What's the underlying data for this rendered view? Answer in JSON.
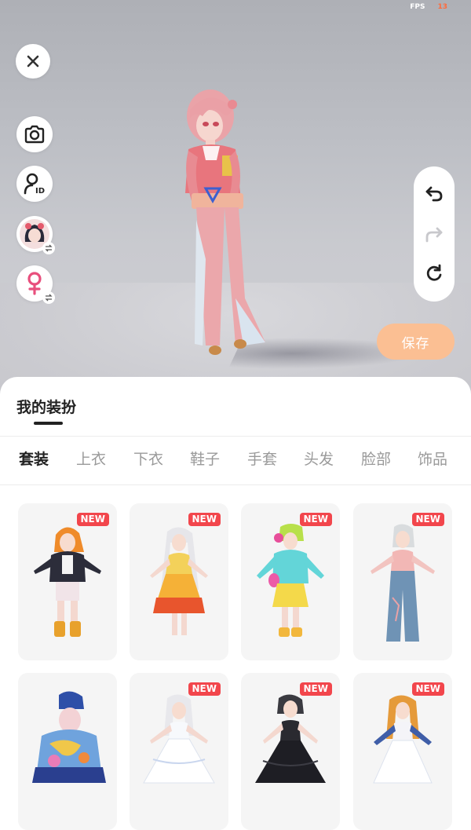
{
  "fps": {
    "label": "FPS",
    "value": "13"
  },
  "actions": {
    "save_label": "保存"
  },
  "sheet": {
    "title": "我的装扮",
    "tabs": [
      "套装",
      "上衣",
      "下衣",
      "鞋子",
      "手套",
      "头发",
      "脸部",
      "饰品"
    ],
    "active_tab": "套装"
  },
  "items": [
    {
      "badge": "NEW",
      "outfit": "black-jacket-orange-hair"
    },
    {
      "badge": "NEW",
      "outfit": "yellow-orange-dress"
    },
    {
      "badge": "NEW",
      "outfit": "cyan-hoodie-yellow-skirt"
    },
    {
      "badge": "NEW",
      "outfit": "pink-top-denim-flare"
    },
    {
      "badge": "",
      "outfit": "blue-floral-costume"
    },
    {
      "badge": "NEW",
      "outfit": "white-wedding-gown"
    },
    {
      "badge": "NEW",
      "outfit": "black-ball-gown"
    },
    {
      "badge": "NEW",
      "outfit": "white-gown-blue-sleeves"
    }
  ],
  "colors": {
    "accent": "#fbbf93",
    "badge": "#f2464c",
    "active_tab": "#222222",
    "inactive_tab": "#9a9a9a"
  }
}
